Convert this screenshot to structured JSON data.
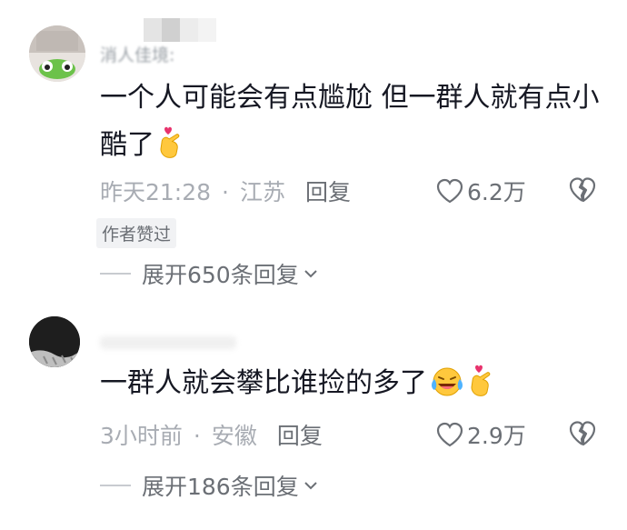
{
  "comments": [
    {
      "username": "消人佳境:",
      "text": "一个人可能会有点尴尬 但一群人就有点小酷了",
      "time": "昨天21:28",
      "location": "江苏",
      "reply_label": "回复",
      "likes": "6.2万",
      "author_badge": "作者赞过",
      "expand_label": "展开650条回复",
      "emojis": [
        "finger-heart-icon"
      ]
    },
    {
      "username": "",
      "text": "一群人就会攀比谁捡的多了",
      "time": "3小时前",
      "location": "安徽",
      "reply_label": "回复",
      "likes": "2.9万",
      "expand_label": "展开186条回复",
      "emojis": [
        "laughing-tears-icon",
        "finger-heart-icon"
      ]
    }
  ],
  "separator_dot": "·",
  "colors": {
    "text": "#161823",
    "meta": "#a8acb3",
    "action": "#6b6f75"
  }
}
